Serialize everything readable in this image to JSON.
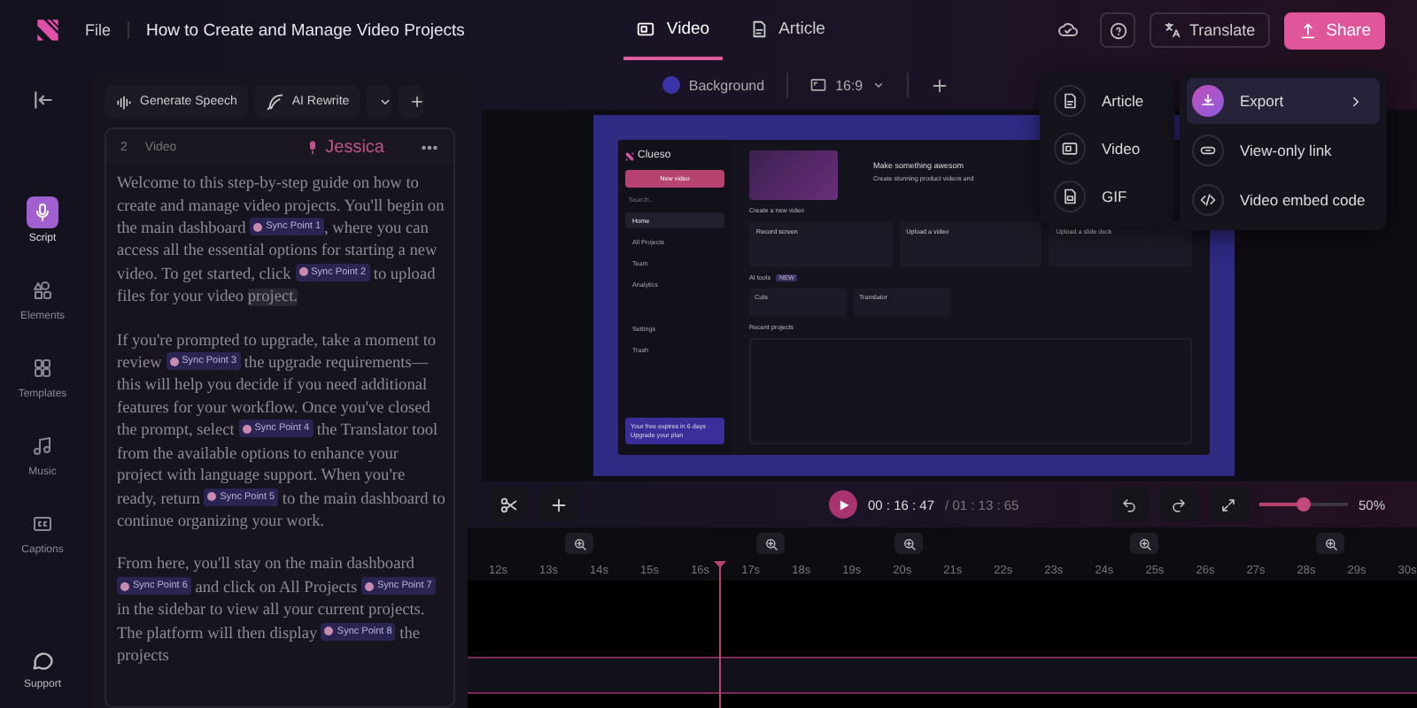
{
  "header": {
    "file_menu": "File",
    "title": "How to Create and Manage Video Projects",
    "translate": "Translate",
    "share": "Share"
  },
  "view_tabs": [
    {
      "label": "Video",
      "kind": "video",
      "selected": true
    },
    {
      "label": "Article",
      "kind": "article",
      "selected": false
    }
  ],
  "rail": {
    "items": [
      {
        "label": "Script",
        "kind": "script",
        "selected": true
      },
      {
        "label": "Elements",
        "kind": "elements",
        "selected": false
      },
      {
        "label": "Templates",
        "kind": "templates",
        "selected": false
      },
      {
        "label": "Music",
        "kind": "music",
        "selected": false
      },
      {
        "label": "Captions",
        "kind": "captions",
        "selected": false
      }
    ],
    "support": "Support"
  },
  "script": {
    "generate": "Generate Speech",
    "rewrite": "AI Rewrite",
    "block_number": "2",
    "block_type": "Video",
    "voice": "Jessica",
    "paragraphs": [
      [
        {
          "kind": "text",
          "text": "Welcome to this step-by-step guide on how to create and manage video projects. You'll begin on the main dashboard "
        },
        {
          "kind": "sync",
          "text": "Sync Point 1"
        },
        {
          "kind": "text",
          "text": ", where you can access all the essential options for starting a new video. To get started, click "
        },
        {
          "kind": "sync",
          "text": "Sync Point 2"
        },
        {
          "kind": "text",
          "text": " to upload files for your video "
        },
        {
          "kind": "highlight",
          "text": "project."
        }
      ],
      [
        {
          "kind": "text",
          "text": "If you're prompted to upgrade, take a moment to review "
        },
        {
          "kind": "sync",
          "text": "Sync Point 3"
        },
        {
          "kind": "text",
          "text": " the upgrade requirements—this will help you decide if you need additional features for your workflow. Once you've closed the prompt, select "
        },
        {
          "kind": "sync",
          "text": "Sync Point 4"
        },
        {
          "kind": "text",
          "text": " the Translator tool from the available options to enhance your project with language support. When you're ready, return "
        },
        {
          "kind": "sync",
          "text": "Sync Point 5"
        },
        {
          "kind": "text",
          "text": " to the main dashboard to continue organizing your work."
        }
      ],
      [
        {
          "kind": "text",
          "text": "From here, you'll stay on the main dashboard "
        },
        {
          "kind": "sync",
          "text": "Sync Point 6"
        },
        {
          "kind": "text",
          "text": " and click on All Projects "
        },
        {
          "kind": "sync",
          "text": "Sync Point 7"
        },
        {
          "kind": "text",
          "text": " in the sidebar to view all your current projects. The platform will then display "
        },
        {
          "kind": "sync",
          "text": "Sync Point 8"
        },
        {
          "kind": "text",
          "text": " the projects"
        }
      ]
    ]
  },
  "canvas_toolbar": {
    "background": "Background",
    "aspect": "16:9"
  },
  "preview": {
    "logo": "Clueso",
    "new_video": "New video",
    "search": "Search...",
    "nav": [
      {
        "label": "Home",
        "selected": true
      },
      {
        "label": "All Projects",
        "selected": false
      },
      {
        "label": "Team",
        "selected": false
      },
      {
        "label": "Analytics",
        "selected": false
      }
    ],
    "nav_bottom": [
      "Settings",
      "Trash"
    ],
    "banner": [
      "Your free expires in 6 days",
      "Upgrade your plan"
    ],
    "hero_title": "Make something awesom",
    "hero_subtitle": "Create stunning product videos and",
    "create_heading": "Create a new video",
    "cards": [
      "Record screen",
      "Upload a video",
      "Upload a slide deck"
    ],
    "ai_heading": "AI tools",
    "ai_badge": "NEW",
    "tools": [
      "Cuts",
      "Translator"
    ],
    "recent": "Recent projects"
  },
  "playback": {
    "current": "00 : 16 : 47",
    "total": "/ 01 : 13 : 65"
  },
  "zoom": {
    "level": 0.5,
    "reading": "50%"
  },
  "timeline": {
    "ticks": [
      "12s",
      "13s",
      "14s",
      "15s",
      "16s",
      "17s",
      "18s",
      "19s",
      "20s",
      "21s",
      "22s",
      "23s",
      "24s",
      "25s",
      "26s",
      "27s",
      "28s",
      "29s",
      "30s"
    ]
  },
  "format_menu": {
    "items": [
      {
        "label": "Article",
        "kind": "article"
      },
      {
        "label": "Video",
        "kind": "video"
      },
      {
        "label": "GIF",
        "kind": "gif"
      }
    ]
  },
  "share_menu": {
    "items": [
      {
        "label": "Export",
        "kind": "export",
        "selected": true
      },
      {
        "label": "View-only link",
        "kind": "link",
        "selected": false
      },
      {
        "label": "Video embed code",
        "kind": "embed",
        "selected": false
      }
    ]
  }
}
